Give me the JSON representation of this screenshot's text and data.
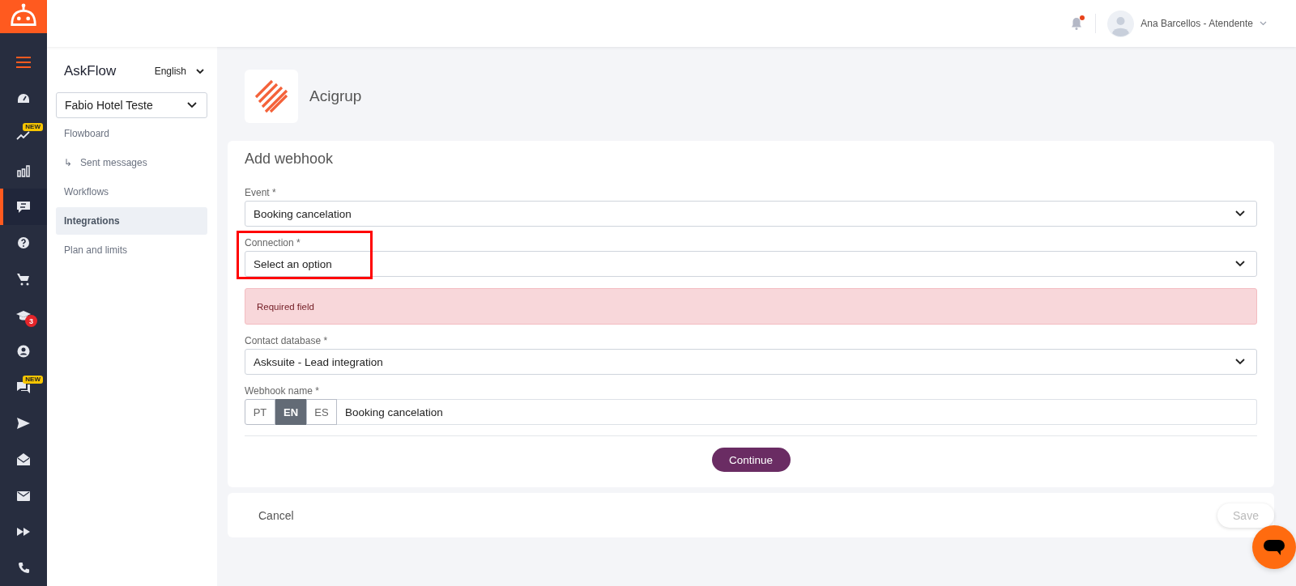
{
  "rail": {
    "items": [
      {
        "selected": false
      },
      {
        "selected": false
      },
      {
        "selected": false,
        "badge": {
          "text": "NEW",
          "kind": "label"
        }
      },
      {
        "selected": false
      },
      {
        "selected": true
      },
      {
        "selected": false
      },
      {
        "selected": false
      },
      {
        "selected": false,
        "badge": {
          "text": "3",
          "kind": "count"
        }
      },
      {
        "selected": false
      },
      {
        "selected": false,
        "badge": {
          "text": "NEW",
          "kind": "label"
        }
      },
      {
        "selected": false
      },
      {
        "selected": false
      },
      {
        "selected": false
      },
      {
        "selected": false
      },
      {
        "selected": false
      }
    ]
  },
  "topbar": {
    "notifications_unread": true,
    "user": "Ana Barcellos - Atendente"
  },
  "sidebar": {
    "brand": "AskFlow",
    "language": "English",
    "property": "Fabio Hotel Teste",
    "items": [
      {
        "label": "Flowboard",
        "selected": false,
        "children": [
          {
            "marker": "↳",
            "label": "Sent messages",
            "selected": false
          }
        ]
      },
      {
        "label": "Workflows",
        "selected": false
      },
      {
        "label": "Integrations",
        "selected": true
      },
      {
        "label": "Plan and limits",
        "selected": false
      }
    ]
  },
  "integration": {
    "name": "Acigrup"
  },
  "form": {
    "title": "Add webhook",
    "fields": [
      {
        "kind": "select",
        "label": "Event *",
        "value": "Booking cancelation"
      },
      {
        "kind": "select",
        "label": "Connection *",
        "value": "Select an option",
        "highlighted": true,
        "error": "Required field"
      },
      {
        "kind": "select",
        "label": "Contact database *",
        "value": "Asksuite - Lead integration"
      },
      {
        "kind": "translated-text",
        "label": "Webhook name *",
        "value": "Booking cancelation",
        "languages": [
          {
            "label": "PT",
            "selected": false
          },
          {
            "label": "EN",
            "selected": true
          },
          {
            "label": "ES",
            "selected": false
          }
        ]
      }
    ],
    "continue_button": "Continue"
  },
  "footer": {
    "cancel": "Cancel",
    "save": {
      "label": "Save",
      "disabled": true
    }
  }
}
